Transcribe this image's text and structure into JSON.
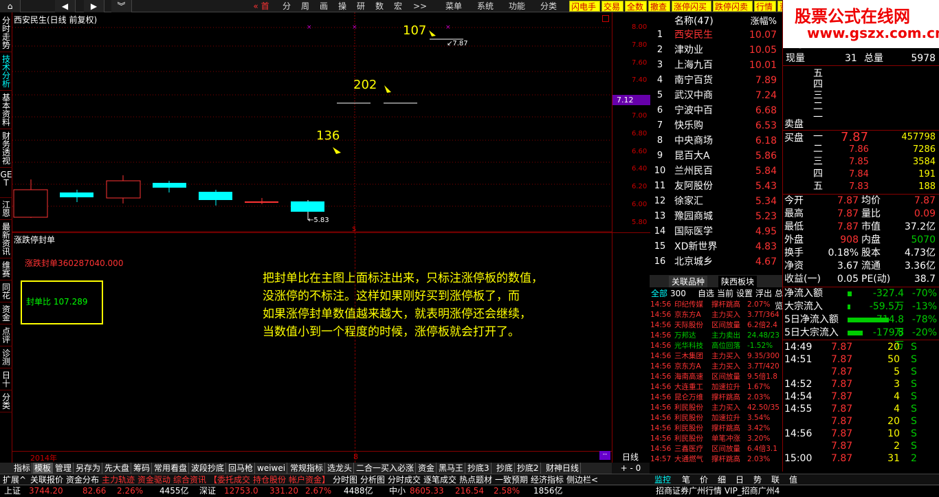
{
  "topbar": {
    "home": "首",
    "menus": [
      "分",
      "周",
      "画",
      "操",
      "研",
      "数",
      "宏"
    ],
    "more": ">>",
    "main_menus": [
      "菜单",
      "系统",
      "功能",
      "分类"
    ],
    "right_tabs": [
      "闪电手",
      "交易",
      "全数",
      "撤查",
      "涨停闪买",
      "跌停闪卖",
      "行情",
      "资讯"
    ],
    "logo": "股票公式在线网",
    "logo_url": "www.gszx.com.cn"
  },
  "leftbar": [
    "分时走势",
    "技术分析",
    "基本资料",
    "财务透视",
    "GET",
    "江恩",
    "最新资讯",
    "维赛",
    "同花",
    "资金",
    "点评",
    "诊测",
    "日十",
    "分类"
  ],
  "chart": {
    "title": "西安民生(日线 前复权)",
    "prices": [
      "8.00",
      "7.80",
      "7.60",
      "7.40",
      "7.20",
      "7.00",
      "6.80",
      "6.60",
      "6.40",
      "6.20",
      "6.00",
      "5.80"
    ],
    "current_price": "7.12",
    "low_label": "5.83",
    "high_label": "7.87",
    "annotations": [
      "107",
      "202",
      "136"
    ]
  },
  "indicator": {
    "title": "涨跌停封单",
    "seal_value_label": "涨跌封单",
    "seal_value": "360287040.000",
    "ratio_label": "封单比",
    "ratio_value": "107.289",
    "note_lines": [
      "把封单比在主图上面标注出来，只标注涨停板的数值，",
      "没涨停的不标注。这样如果刚好买到涨停板了，而",
      "如果涨停封单数值越来越大，就表明涨停还会继续，",
      "当数值小到一个程度的时候，涨停板就会打开了。"
    ],
    "year_label": "2014年",
    "marker": "8",
    "scale": "日线"
  },
  "quote_list": {
    "header_name": "名称(47)",
    "header_change": "涨幅%",
    "rows": [
      {
        "n": "1",
        "name": "西安民生",
        "chg": "10.07"
      },
      {
        "n": "2",
        "name": "津劝业",
        "chg": "10.05"
      },
      {
        "n": "3",
        "name": "上海九百",
        "chg": "10.01"
      },
      {
        "n": "4",
        "name": "南宁百货",
        "chg": "7.89"
      },
      {
        "n": "5",
        "name": "武汉中商",
        "chg": "7.24"
      },
      {
        "n": "6",
        "name": "宁波中百",
        "chg": "6.68"
      },
      {
        "n": "7",
        "name": "快乐购",
        "chg": "6.53"
      },
      {
        "n": "8",
        "name": "中央商场",
        "chg": "6.18"
      },
      {
        "n": "9",
        "name": "昆百大A",
        "chg": "5.86"
      },
      {
        "n": "10",
        "name": "兰州民百",
        "chg": "5.84"
      },
      {
        "n": "11",
        "name": "友阿股份",
        "chg": "5.43"
      },
      {
        "n": "12",
        "name": "徐家汇",
        "chg": "5.34"
      },
      {
        "n": "13",
        "name": "豫园商城",
        "chg": "5.23"
      },
      {
        "n": "14",
        "name": "国际医学",
        "chg": "4.95"
      },
      {
        "n": "15",
        "name": "XD新世界",
        "chg": "4.83"
      },
      {
        "n": "16",
        "name": "北京城乡",
        "chg": "4.67"
      }
    ],
    "tabs": [
      "关联品种",
      "陕西板块"
    ],
    "filters": [
      "全部",
      "300",
      "自选",
      "当前",
      "设置",
      "浮出",
      "总览"
    ]
  },
  "ticks": [
    {
      "t": "14:56",
      "n": "印纪传媒",
      "a": "撑杆跳高",
      "v": "2.07%"
    },
    {
      "t": "14:56",
      "n": "京东方A",
      "a": "主力买入",
      "v": "3.7T/364"
    },
    {
      "t": "14:56",
      "n": "天际股份",
      "a": "区间放量",
      "v": "6.2倍2.4"
    },
    {
      "t": "14:56",
      "n": "万邦达",
      "a": "主力卖出",
      "v": "24.48/23"
    },
    {
      "t": "14:56",
      "n": "光华科技",
      "a": "高位回落",
      "v": "-1.52%"
    },
    {
      "t": "14:56",
      "n": "三木集团",
      "a": "主力买入",
      "v": "9.35/300"
    },
    {
      "t": "14:56",
      "n": "京东方A",
      "a": "主力买入",
      "v": "3.7T/420"
    },
    {
      "t": "14:56",
      "n": "海南高速",
      "a": "区间放量",
      "v": "9.5倍1.8"
    },
    {
      "t": "14:56",
      "n": "大连重工",
      "a": "加速拉升",
      "v": "1.67%"
    },
    {
      "t": "14:56",
      "n": "昆仑万维",
      "a": "撑杆跳高",
      "v": "2.03%"
    },
    {
      "t": "14:56",
      "n": "利民股份",
      "a": "主力买入",
      "v": "42.50/35"
    },
    {
      "t": "14:56",
      "n": "利民股份",
      "a": "加速拉升",
      "v": "3.54%"
    },
    {
      "t": "14:56",
      "n": "利民股份",
      "a": "撑杆跳高",
      "v": "3.42%"
    },
    {
      "t": "14:56",
      "n": "利民股份",
      "a": "单笔冲涨",
      "v": "3.20%"
    },
    {
      "t": "14:56",
      "n": "三鑫医疗",
      "a": "区间放量",
      "v": "6.4倍3.1"
    },
    {
      "t": "14:57",
      "n": "大通燃气",
      "a": "撑杆跳高",
      "v": "2.03%"
    }
  ],
  "stock": {
    "price": "7.87",
    "now_label": "现量",
    "now_val": "31",
    "total_label": "总量",
    "total_val": "5978",
    "sell_label": "卖盘",
    "buy_label": "买盘",
    "sell_levels": [
      "五",
      "四",
      "三",
      "二",
      "一"
    ],
    "buy_levels": [
      {
        "l": "一",
        "p": "7.87",
        "v": "457798"
      },
      {
        "l": "二",
        "p": "7.86",
        "v": "7286"
      },
      {
        "l": "三",
        "p": "7.85",
        "v": "3584"
      },
      {
        "l": "四",
        "p": "7.84",
        "v": "191"
      },
      {
        "l": "五",
        "p": "7.83",
        "v": "188"
      }
    ],
    "stats": [
      {
        "a": "今开",
        "b": "7.87",
        "c": "均价",
        "d": "7.87"
      },
      {
        "a": "最高",
        "b": "7.87",
        "c": "量比",
        "d": "0.09"
      },
      {
        "a": "最低",
        "b": "7.87",
        "c": "市值",
        "d": "37.2亿"
      },
      {
        "a": "外盘",
        "b": "908",
        "c": "内盘",
        "d": "5070"
      },
      {
        "a": "换手",
        "b": "0.18%",
        "c": "股本",
        "d": "4.73亿"
      },
      {
        "a": "净资",
        "b": "3.67",
        "c": "流通",
        "d": "3.36亿"
      },
      {
        "a": "收益(一)",
        "b": "0.05",
        "c": "PE(动)",
        "d": "38.7"
      }
    ],
    "flows": [
      {
        "a": "净流入额",
        "v": "-327.4万",
        "p": "-70%"
      },
      {
        "a": "大宗流入",
        "v": "-59.5万",
        "p": "-13%"
      },
      {
        "a": "5日净流入额",
        "v": "-714.8万",
        "p": "-78%"
      },
      {
        "a": "5日大宗流入",
        "v": "-179.8万",
        "p": "-20%"
      }
    ],
    "trades": [
      {
        "t": "14:49",
        "p": "7.87",
        "v": "20",
        "s": "S"
      },
      {
        "t": "14:51",
        "p": "7.87",
        "v": "50",
        "s": "S"
      },
      {
        "t": "",
        "p": "7.87",
        "v": "5",
        "s": "S"
      },
      {
        "t": "14:52",
        "p": "7.87",
        "v": "3",
        "s": "S"
      },
      {
        "t": "14:54",
        "p": "7.87",
        "v": "4",
        "s": "S"
      },
      {
        "t": "14:55",
        "p": "7.87",
        "v": "4",
        "s": "S"
      },
      {
        "t": "",
        "p": "7.87",
        "v": "20",
        "s": "S"
      },
      {
        "t": "14:56",
        "p": "7.87",
        "v": "10",
        "s": "S"
      },
      {
        "t": "",
        "p": "7.87",
        "v": "2",
        "s": "S"
      },
      {
        "t": "15:00",
        "p": "7.87",
        "v": "31",
        "s": "2"
      }
    ]
  },
  "bottom_tabs": [
    "指标",
    "模板",
    "管理",
    "另存为",
    "先大盘",
    "筹码",
    "常用看盘",
    "波段抄底",
    "回马枪",
    "weiwei",
    "常规指标",
    "选龙头",
    "二合一买入必涨",
    "资金",
    "黑马王",
    "抄底3",
    "抄底",
    "抄底2",
    "财神日线"
  ],
  "bottom_tabs2": [
    "扩展^",
    "关联报价",
    "资金分布",
    "主力轨迹",
    "资金驱动",
    "综合资讯",
    "【委托成交",
    "持仓股份",
    "帐户资金】",
    "分时图",
    "分析图",
    "分时成交",
    "逐笔成交",
    "热点题材",
    "一致预期",
    "经济指标",
    "侧边栏<"
  ],
  "right_tabs2": [
    "监控",
    "笔",
    "价",
    "细",
    "日",
    "势",
    "联",
    "值"
  ],
  "status": {
    "sh": "上证",
    "sh_v": "3744.20",
    "sh_c": "82.66",
    "sh_p": "2.26%",
    "sh_amt": "4455亿",
    "sz": "深证",
    "sz_v": "12753.0",
    "sz_c": "331.20",
    "sz_p": "2.67%",
    "sz_amt": "4488亿",
    "zx": "中小",
    "zx_v": "8605.33",
    "zx_c": "216.54",
    "zx_p": "2.58%",
    "zx_amt": "1856亿",
    "broker": "招商证券广州行情 VIP_招商广州4"
  }
}
